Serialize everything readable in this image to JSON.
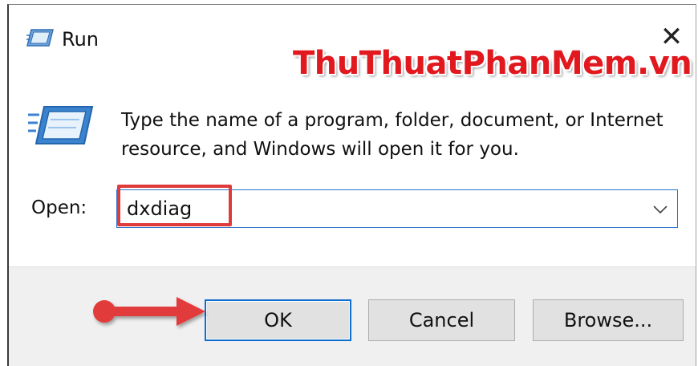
{
  "dialog": {
    "title": "Run",
    "close_glyph": "✕",
    "watermark": "ThuThuatPhanMem.vn",
    "description_line1": "Type the name of a program, folder, document, or Internet",
    "description_line2": "resource, and Windows will open it for you.",
    "open_label": "Open:",
    "open_value": "dxdiag",
    "buttons": {
      "ok": "OK",
      "cancel": "Cancel",
      "browse": "Browse..."
    }
  },
  "icons": {
    "title": "run-dialog-icon",
    "big": "run-program-icon",
    "dropdown": "chevron-down-icon",
    "annotation": "red-arrow-pointer"
  },
  "colors": {
    "accent": "#0c6fd0",
    "highlight": "#e03a3a",
    "watermark": "#e2181f",
    "footer": "#f0f0f0"
  }
}
